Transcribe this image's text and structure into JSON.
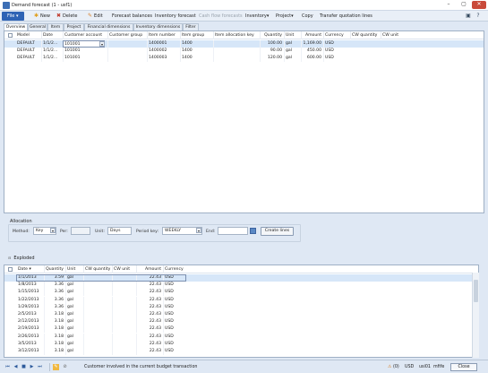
{
  "window": {
    "title": "Demand forecast (1 - usf1)",
    "min": "–",
    "max": "▢",
    "close": "✕"
  },
  "ribbon": {
    "file": "File",
    "new": "New",
    "delete": "Delete",
    "edit": "Edit",
    "forecast_balances": "Forecast balances",
    "inventory_forecast": "Inventory forecast",
    "cash_flow_forecasts": "Cash flow forecasts",
    "inventory": "Inventory",
    "project": "Project",
    "copy": "Copy",
    "transfer_quotation_lines": "Transfer quotation lines"
  },
  "tabs": [
    "Overview",
    "General",
    "Item",
    "Project",
    "Financial dimensions",
    "Inventory dimensions",
    "Filter"
  ],
  "upper_grid": {
    "columns": [
      "Model",
      "Date",
      "Customer account",
      "Customer group",
      "Item number",
      "Item group",
      "Item allocation key",
      "Quantity",
      "Unit",
      "Amount",
      "Currency",
      "CW quantity",
      "CW unit"
    ],
    "rows": [
      {
        "model": "DEFAULT",
        "date": "1/1/2...",
        "customer": "101001",
        "group": "",
        "item": "1400001",
        "itemgroup": "1400",
        "alloc": "",
        "qty": "100.00",
        "unit": "gal",
        "amount": "1,169.00",
        "currency": "USD"
      },
      {
        "model": "DEFAULT",
        "date": "1/1/2...",
        "customer": "101001",
        "group": "",
        "item": "1400002",
        "itemgroup": "1400",
        "alloc": "",
        "qty": "90.00",
        "unit": "gal",
        "amount": "450.00",
        "currency": "USD"
      },
      {
        "model": "DEFAULT",
        "date": "1/1/2...",
        "customer": "101001",
        "group": "",
        "item": "1400003",
        "itemgroup": "1400",
        "alloc": "",
        "qty": "120.00",
        "unit": "gal",
        "amount": "600.00",
        "currency": "USD"
      }
    ]
  },
  "allocation": {
    "group_label": "Allocation",
    "method_label": "Method:",
    "method_value": "Key",
    "per_label": "Per:",
    "per_value": "",
    "unit_label": "Unit:",
    "unit_value": "Days",
    "period_key_label": "Period key:",
    "period_key_value": "WEEKLY",
    "end_label": "End:",
    "end_value": "",
    "create_lines": "Create lines"
  },
  "exploded_label": "Exploded",
  "lower_grid": {
    "columns": [
      "Date",
      "Quantity",
      "Unit",
      "CW quantity",
      "CW unit",
      "Amount",
      "Currency"
    ],
    "rows": [
      {
        "date": "1/1/2013",
        "qty": "3.59",
        "unit": "gal",
        "amount": "22.43",
        "currency": "USD"
      },
      {
        "date": "1/8/2013",
        "qty": "3.36",
        "unit": "gal",
        "amount": "22.43",
        "currency": "USD"
      },
      {
        "date": "1/15/2013",
        "qty": "3.36",
        "unit": "gal",
        "amount": "22.43",
        "currency": "USD"
      },
      {
        "date": "1/22/2013",
        "qty": "3.36",
        "unit": "gal",
        "amount": "22.43",
        "currency": "USD"
      },
      {
        "date": "1/29/2013",
        "qty": "3.36",
        "unit": "gal",
        "amount": "22.43",
        "currency": "USD"
      },
      {
        "date": "2/5/2013",
        "qty": "3.18",
        "unit": "gal",
        "amount": "22.43",
        "currency": "USD"
      },
      {
        "date": "2/12/2013",
        "qty": "3.18",
        "unit": "gal",
        "amount": "22.43",
        "currency": "USD"
      },
      {
        "date": "2/19/2013",
        "qty": "3.18",
        "unit": "gal",
        "amount": "22.43",
        "currency": "USD"
      },
      {
        "date": "2/26/2013",
        "qty": "3.18",
        "unit": "gal",
        "amount": "22.43",
        "currency": "USD"
      },
      {
        "date": "3/5/2013",
        "qty": "3.18",
        "unit": "gal",
        "amount": "22.43",
        "currency": "USD"
      },
      {
        "date": "3/12/2013",
        "qty": "3.18",
        "unit": "gal",
        "amount": "22.43",
        "currency": "USD"
      }
    ]
  },
  "status": {
    "text": "Customer involved in the current budget transaction",
    "badge": "(0)",
    "currency": "USD",
    "user": "usi01",
    "company": "mfife",
    "close": "Close"
  },
  "colors": {
    "accent": "#2e63b5",
    "selection": "#d6e6f8",
    "chrome": "#dfe8f4"
  }
}
